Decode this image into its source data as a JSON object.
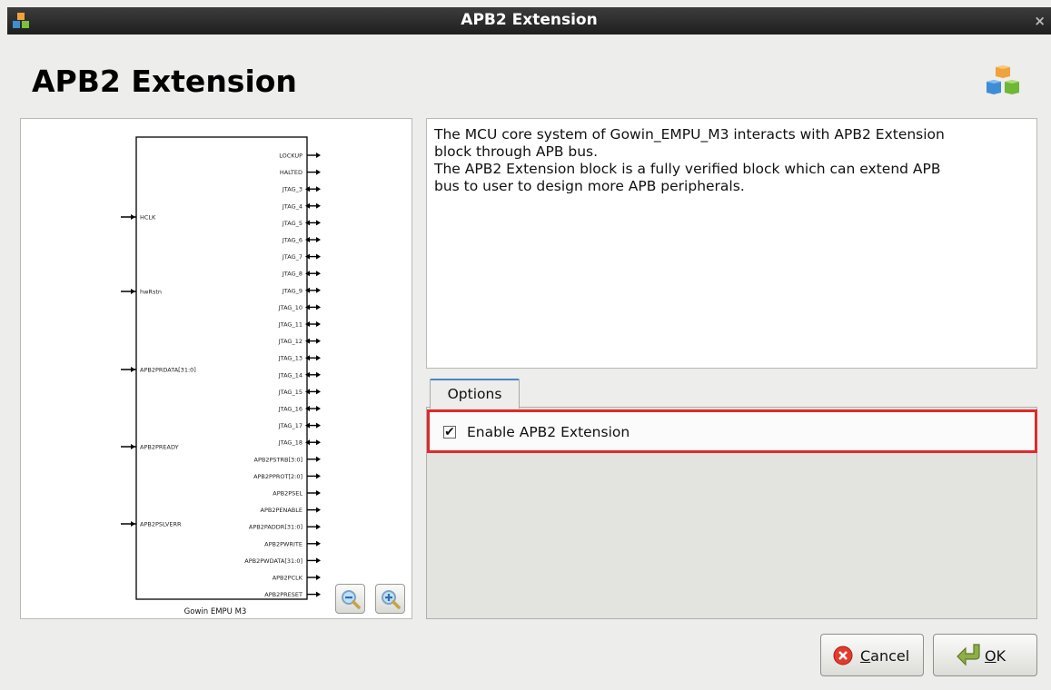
{
  "window": {
    "title": "APB2 Extension",
    "close_glyph": "×"
  },
  "heading": "APB2 Extension",
  "diagram": {
    "block_label": "Gowin EMPU M3",
    "inputs": [
      "HCLK",
      "hwRstn",
      "APB2PRDATA[31:0]",
      "APB2PREADY",
      "APB2PSLVERR"
    ],
    "outputs": [
      "LOCKUP",
      "HALTED",
      "JTAG_3",
      "JTAG_4",
      "JTAG_5",
      "JTAG_6",
      "JTAG_7",
      "JTAG_8",
      "JTAG_9",
      "JTAG_10",
      "JTAG_11",
      "JTAG_12",
      "JTAG_13",
      "JTAG_14",
      "JTAG_15",
      "JTAG_16",
      "JTAG_17",
      "JTAG_18",
      "APB2PSTRB[3:0]",
      "APB2PPROT[2:0]",
      "APB2PSEL",
      "APB2PENABLE",
      "APB2PADDR[31:0]",
      "APB2PWRITE",
      "APB2PWDATA[31:0]",
      "APB2PCLK",
      "APB2PRESET"
    ]
  },
  "description": [
    "The MCU core system of Gowin_EMPU_M3 interacts with APB2 Extension",
    "block through APB bus.",
    "The APB2 Extension block is a fully verified block which can extend APB",
    "bus to user to design more APB peripherals."
  ],
  "options": {
    "tab_label": "Options",
    "enable_label": "Enable APB2 Extension",
    "enable_checked": true,
    "check_glyph": "✔"
  },
  "buttons": {
    "cancel_mnemonic": "C",
    "cancel_rest": "ancel",
    "ok_mnemonic": "O",
    "ok_rest": "K"
  },
  "icons": {
    "app": "cubes-icon",
    "zoom_out": "zoom-out-icon",
    "zoom_in": "zoom-in-icon",
    "cancel": "cancel-icon",
    "ok": "ok-arrow-icon"
  },
  "colors": {
    "highlight": "#e02a2a",
    "tab_accent": "#4a86c5"
  }
}
